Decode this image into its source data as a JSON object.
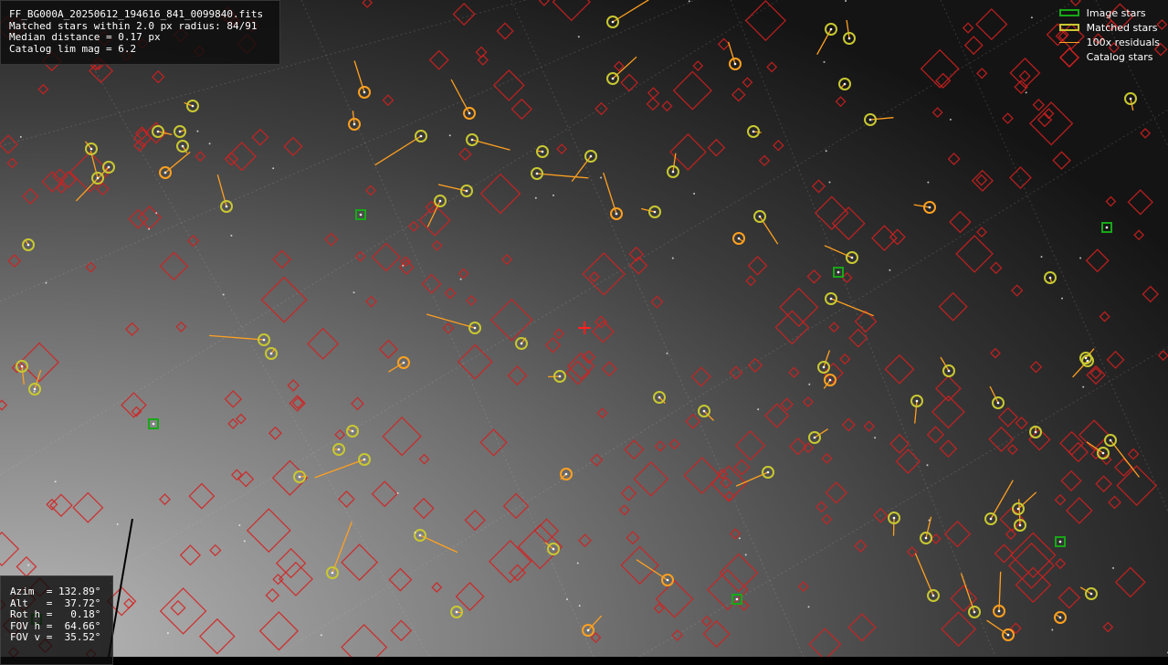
{
  "info": {
    "filename": "FF_BG000A_20250612_194616_841_0099840.fits",
    "matched": "Matched stars within 2.0 px radius: 84/91",
    "median": "Median distance = 0.17 px",
    "catalog": "Catalog lim mag = 6.2"
  },
  "pointing": {
    "azim": "Azim  = 132.89°",
    "alt": "Alt   =  37.72°",
    "roth": "Rot h =   0.18°",
    "fovh": "FOV h =  64.66°",
    "fovv": "FOV v =  35.52°"
  },
  "legend": {
    "image": "Image stars",
    "matched": "Matched stars",
    "residuals": "100x residuals",
    "catalog": "Catalog stars"
  },
  "colors": {
    "image_star": "#17a817",
    "matched_star": "#c8c832",
    "residual": "#ffa020",
    "catalog_star": "#d42020"
  }
}
